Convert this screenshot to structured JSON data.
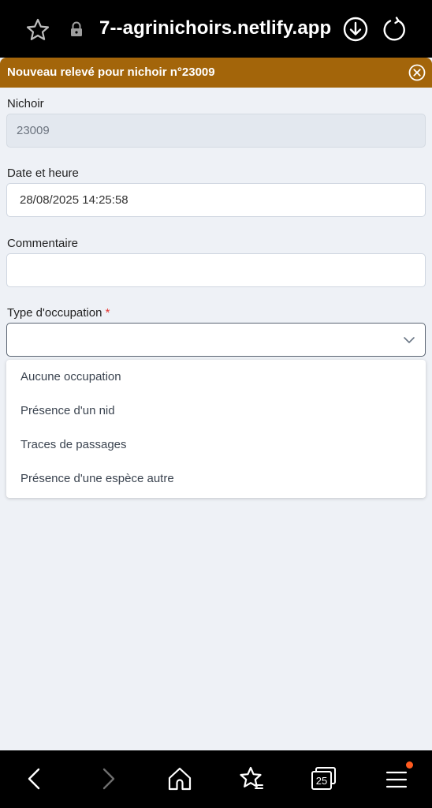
{
  "browser": {
    "url": "7--agrinichoirs.netlify.app",
    "icons": [
      "star-icon",
      "lock-icon",
      "download-icon",
      "reload-icon"
    ]
  },
  "modal": {
    "title": "Nouveau relevé pour nichoir n°23009",
    "header_color": "#a3650a",
    "close_icon": "close-circle-icon"
  },
  "form": {
    "nichoir": {
      "label": "Nichoir",
      "value": "23009"
    },
    "date": {
      "label": "Date et heure",
      "value": "28/08/2025 14:25:58"
    },
    "commentaire": {
      "label": "Commentaire",
      "value": ""
    },
    "occupation": {
      "label": "Type d'occupation",
      "required_mark": "*",
      "value": "",
      "options": [
        "Aucune occupation",
        "Présence d'un nid",
        "Traces de passages",
        "Présence d'une espèce autre"
      ]
    }
  },
  "bottom_nav": {
    "tab_count": "25",
    "icons": [
      "back-icon",
      "forward-icon",
      "home-icon",
      "favorites-icon",
      "tabs-icon",
      "menu-icon"
    ],
    "notification_color": "#ff5a1f"
  }
}
